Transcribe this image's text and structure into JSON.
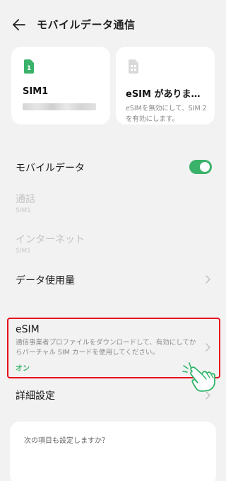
{
  "header": {
    "title": "モバイルデータ通信",
    "back_icon": "arrow-left-icon"
  },
  "sim_cards": [
    {
      "slot_number": "1",
      "name": "SIM1",
      "icon": "sim-card-icon",
      "icon_color": "#3ab26a"
    },
    {
      "name": "eSIM がありま…",
      "description": "eSIMを無効にして、SIM 2 を有効にします。",
      "icon": "sim-card-icon",
      "icon_color": "#d9d9d9"
    }
  ],
  "settings": {
    "mobile_data": {
      "label": "モバイルデータ",
      "enabled": true
    },
    "calls": {
      "label": "通話",
      "sub": "SIM1"
    },
    "internet": {
      "label": "インターネット",
      "sub": "SIM1"
    },
    "data_usage": {
      "label": "データ使用量"
    },
    "esim": {
      "label": "eSIM",
      "description": "通信事業者プロファイルをダウンロードして、有効にしてからバーチャル SIM カードを使用してください。",
      "status": "オン"
    },
    "advanced": {
      "label": "詳細設定"
    }
  },
  "suggestions": {
    "title": "次の項目も設定しますか？"
  },
  "colors": {
    "accent": "#3ab26a",
    "highlight_border": "#e8101c",
    "background": "#f2f2f2"
  }
}
